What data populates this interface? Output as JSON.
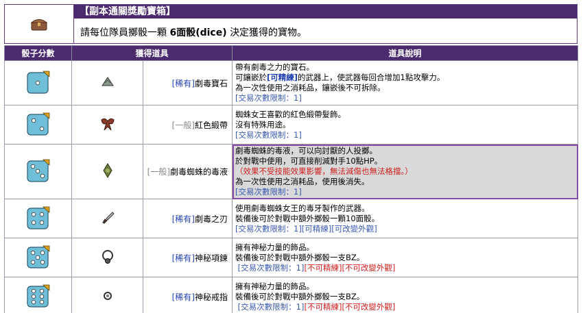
{
  "header": {
    "title": "【副本通關獎勵寶箱】",
    "subtitle_pre": "請每位隊員擲骰一顆",
    "subtitle_bold": "6面骰(dice)",
    "subtitle_post": "決定獲得的寶物。",
    "chest_icon": "treasure-chest-icon"
  },
  "columns": [
    "骰子分數",
    "獲得道具",
    "道具說明"
  ],
  "rows": [
    {
      "dice": 1,
      "grade": "[稀有]",
      "name": "劇毒寶石",
      "icon": "gem-icon",
      "lines": [
        "帶有劇毒之力的寶石。",
        "可鑲嵌於",
        "[可精練]",
        "的武器上，使武器每回合增加1點攻擊力。",
        "為一次性使用之消耗品，鑲嵌後不可拆除。"
      ],
      "limit": "[交易次數限制：1]"
    },
    {
      "dice": 2,
      "grade": "[一般]",
      "name": "紅色緞帶",
      "icon": "ribbon-icon",
      "lines": [
        "蜘蛛女王喜歡的紅色緞帶髮飾。",
        "沒有特殊用途。"
      ],
      "limit": "[交易次數限制：1]"
    },
    {
      "dice": 3,
      "grade": "[一般]",
      "name": "劇毒蜘蛛的毒液",
      "icon": "potion-icon",
      "lines": [
        "劇毒蜘蛛的毒液，可以向討厭的人投擲。",
        "於對戰中使用，可直接削減對手10點HP。",
        "（效果不受技能效果影響，無法減傷也無法格擋。）",
        "為一次性使用之消耗品，使用後消失。"
      ],
      "limit": "[交易次數限制：1]"
    },
    {
      "dice": 4,
      "grade": "[稀有]",
      "name": "劇毒之刃",
      "icon": "dagger-icon",
      "lines": [
        "使用劇毒蜘蛛女王的毒牙製作的武器。",
        "裝備後可於對戰中額外擲骰一顆10面骰。"
      ],
      "limit": "[交易次數限制：1][可精練][可改變外觀]"
    },
    {
      "dice": 5,
      "grade": "[稀有]",
      "name": "神秘項鍊",
      "icon": "necklace-icon",
      "lines": [
        "擁有神秘力量的飾品。",
        "裝備後可於對戰中額外擲骰一支BZ。"
      ],
      "limit_a": "[交易次數限制：1]",
      "limit_b": "[不可精練][不可改變外觀]"
    },
    {
      "dice": 6,
      "grade": "[稀有]",
      "name": "神秘戒指",
      "icon": "ring-icon",
      "lines": [
        "擁有神秘力量的飾品。",
        "裝備後可於對戰中額外擲骰一支BZ。"
      ],
      "limit_a": "[交易次數限制：1]",
      "limit_b": "[不可精練][不可改變外觀]"
    }
  ]
}
